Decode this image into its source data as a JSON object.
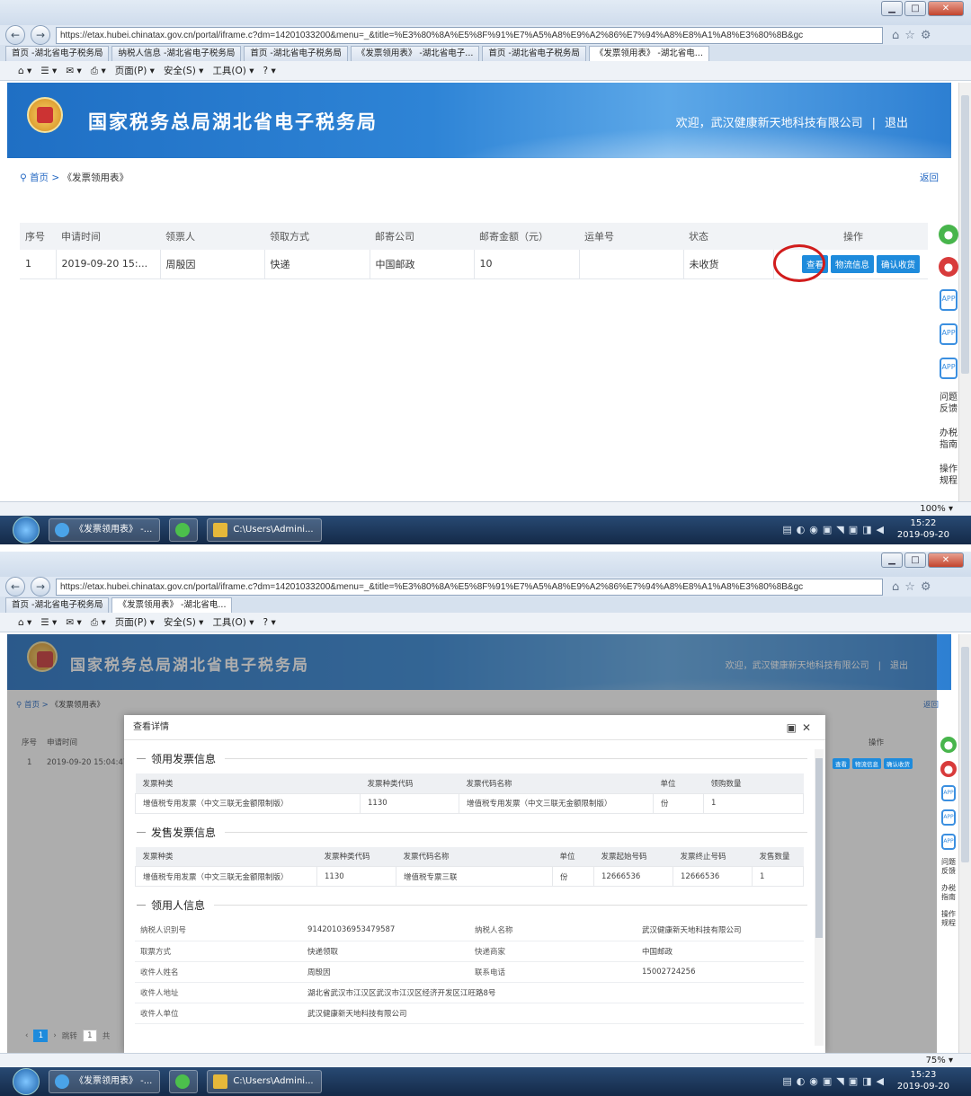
{
  "shot1": {
    "address": "https://etax.hubei.chinatax.gov.cn/portal/iframe.c?dm=14201033200&menu=_&title=%E3%80%8A%E5%8F%91%E7%A5%A8%E9%A2%86%E7%94%A8%E8%A1%A8%E3%80%8B&gc",
    "tabs": [
      "首页 -湖北省电子税务局",
      "纳税人信息 -湖北省电子税务局",
      "首页 -湖北省电子税务局",
      "《发票领用表》 -湖北省电子...",
      "首页 -湖北省电子税务局",
      "《发票领用表》 -湖北省电..."
    ],
    "zoom": "100%",
    "time": "15:22",
    "date": "2019-09-20"
  },
  "shot2": {
    "address": "https://etax.hubei.chinatax.gov.cn/portal/iframe.c?dm=14201033200&menu=_&title=%E3%80%8A%E5%8F%91%E7%A5%A8%E9%A2%86%E7%94%A8%E8%A1%A8%E3%80%8B&gc",
    "tabs": [
      "首页 -湖北省电子税务局",
      "《发票领用表》 -湖北省电..."
    ],
    "zoom": "75%",
    "time": "15:23",
    "date": "2019-09-20"
  },
  "toolbar": {
    "page": "页面(P) ▾",
    "safety": "安全(S) ▾",
    "tools": "工具(O) ▾"
  },
  "site": {
    "title": "国家税务总局湖北省电子税务局",
    "welcome": "欢迎，武汉健康新天地科技有限公司",
    "logout": "退出",
    "home": "首页",
    "current": "《发票领用表》",
    "back": "返回"
  },
  "list": {
    "headers": [
      "序号",
      "申请时间",
      "领票人",
      "领取方式",
      "邮寄公司",
      "邮寄金额（元）",
      "运单号",
      "状态",
      "操作"
    ],
    "row": {
      "no": "1",
      "time": "2019-09-20 15:...",
      "time_full": "2019-09-20 15:04:47",
      "person": "周殷因",
      "method": "快递",
      "company": "中国邮政",
      "amount": "10",
      "waybill": "",
      "status": "未收货"
    },
    "actions": {
      "view": "查看",
      "logistics": "物流信息",
      "confirm": "确认收货"
    }
  },
  "side": {
    "feedback": "问题反馈",
    "guide": "办税指南",
    "rules": "操作规程"
  },
  "modal": {
    "title": "查看详情",
    "sec1": "领用发票信息",
    "t1_headers": [
      "发票种类",
      "发票种类代码",
      "发票代码名称",
      "单位",
      "领购数量"
    ],
    "t1_row": [
      "增值税专用发票（中文三联无金额限制版）",
      "1130",
      "增值税专用发票（中文三联无金额限制版）",
      "份",
      "1"
    ],
    "sec2": "发售发票信息",
    "t2_headers": [
      "发票种类",
      "发票种类代码",
      "发票代码名称",
      "单位",
      "发票起始号码",
      "发票终止号码",
      "发售数量"
    ],
    "t2_row": [
      "增值税专用发票（中文三联无金额限制版）",
      "1130",
      "增值税专票三联",
      "份",
      "12666536",
      "12666536",
      "1"
    ],
    "sec3": "领用人信息",
    "kv": {
      "taxid_k": "纳税人识别号",
      "taxid_v": "914201036953479587",
      "taxname_k": "纳税人名称",
      "taxname_v": "武汉健康新天地科技有限公司",
      "method_k": "取票方式",
      "method_v": "快递领取",
      "express_k": "快递商家",
      "express_v": "中国邮政",
      "name_k": "收件人姓名",
      "name_v": "周殷因",
      "phone_k": "联系电话",
      "phone_v": "15002724256",
      "addr_k": "收件人地址",
      "addr_v": "湖北省武汉市江汉区武汉市江汉区经济开发区江旺路8号",
      "unit_k": "收件人单位",
      "unit_v": "武汉健康新天地科技有限公司"
    }
  },
  "pager": {
    "page": "1",
    "total_label": "共",
    "jump_label": "跳转"
  },
  "taskbar": {
    "ie_label": "《发票领用表》 -...",
    "folder_label": "C:\\Users\\Admini..."
  }
}
